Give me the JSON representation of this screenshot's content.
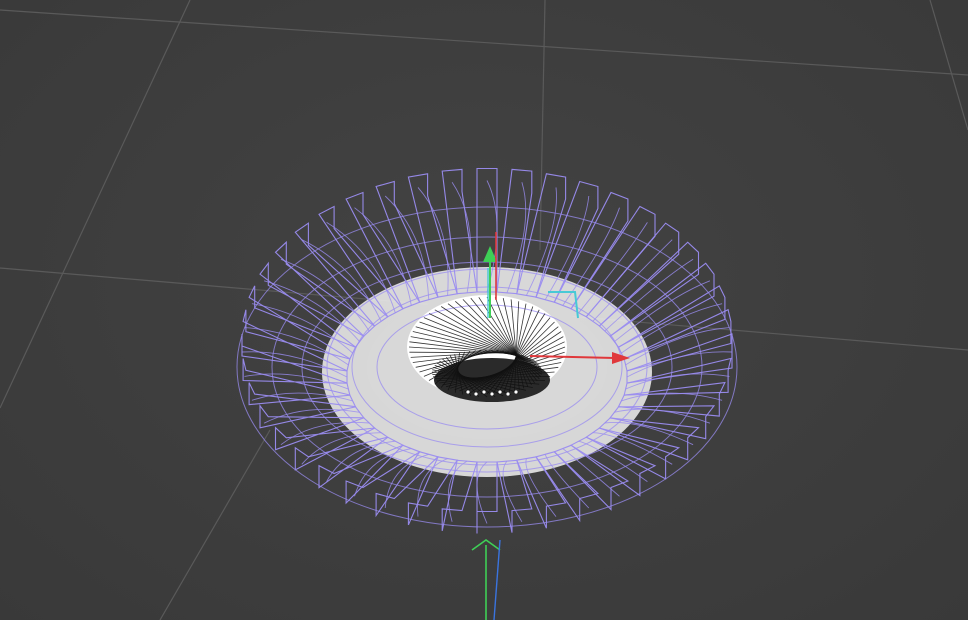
{
  "viewport": {
    "colors": {
      "background": "#3d3d3d",
      "grid": "#5a5a5a",
      "wireframe": "#9a8cf0",
      "geometry_fill": "#f2f2f2",
      "inner_edges": "#111111",
      "axis_x": "#e0383b",
      "axis_y": "#3ecf56",
      "axis_z": "#3a74e0",
      "axis_gizmo_secondary": "#47c9d6"
    },
    "icons": {
      "object_gizmo": "move-gizmo-icon",
      "world_axis": "world-axis-icon"
    }
  }
}
